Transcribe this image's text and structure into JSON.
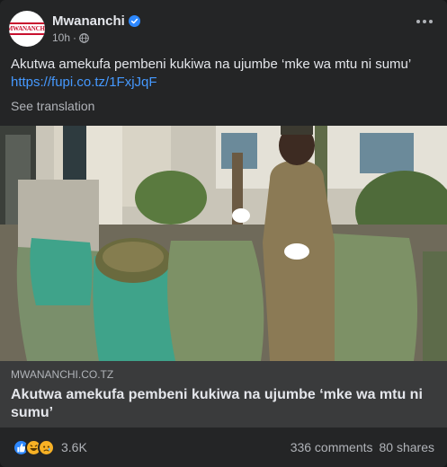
{
  "post": {
    "page_name": "Mwananchi",
    "avatar_text": "MWANANCHI",
    "time": "10h",
    "separator": "·",
    "text": "Akutwa amekufa pembeni kukiwa na ujumbe ‘mke wa mtu ni sumu’",
    "link_url": "https://fupi.co.tz/1FxjJqF",
    "see_translation": "See translation"
  },
  "link_preview": {
    "domain": "MWANANCHI.CO.TZ",
    "title": "Akutwa amekufa pembeni kukiwa na ujumbe ‘mke wa mtu ni sumu’"
  },
  "footer": {
    "reaction_count": "3.6K",
    "comments": "336 comments",
    "shares": "80 shares"
  },
  "icons": [
    "verified-badge-icon",
    "globe-icon",
    "more-options-icon",
    "like-reaction-icon",
    "haha-reaction-icon",
    "sad-reaction-icon"
  ],
  "colors": {
    "link": "#4599ff",
    "verified": "#2d88ff",
    "card": "#242526",
    "link_box": "#3a3b3c"
  }
}
